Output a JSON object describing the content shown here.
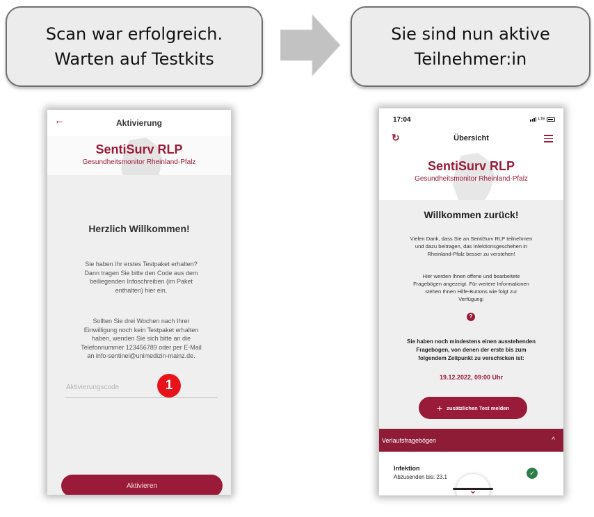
{
  "callouts": {
    "left": "Scan war erfolgreich.\nWarten auf Testkits",
    "right": "Sie sind nun aktive\nTeilnehmer:in"
  },
  "phone_activation": {
    "back_icon": "arrow-left-icon",
    "header_title": "Aktivierung",
    "brand_title": "SentiSurv RLP",
    "brand_subtitle": "Gesundheitsmonitor Rheinland-Pfalz",
    "welcome_title": "Herzlich Willkommen!",
    "paragraph_1": "Sie haben Ihr erstes Testpaket erhalten?\nDann tragen Sie bitte den Code aus dem\nbeiliegenden Infoschreiben (im Paket\nenthalten) hier ein.",
    "paragraph_2": "Sollten Sie drei Wochen nach Ihrer\nEinwilligung noch kein Testpaket erhalten\nhaben, wenden Sie sich bitte an die\nTelefonnummer 123456789 oder per E-Mail\nan info-sentinel@unimedizin-mainz.de.",
    "code_placeholder": "Aktivierungscode",
    "step_badge": "1",
    "activate_button": "Aktivieren",
    "accent_color": "#9a1b39",
    "badge_color": "#e8121a"
  },
  "phone_overview": {
    "status_time": "17:04",
    "status_network": "LTE",
    "refresh_icon": "refresh-icon",
    "header_title": "Übersicht",
    "menu_icon": "hamburger-menu-icon",
    "brand_title": "SentiSurv RLP",
    "brand_subtitle": "Gesundheitsmonitor Rheinland-Pfalz",
    "welcome_title": "Willkommen zurück!",
    "paragraph_1": "Vielen Dank, dass Sie an SentiSurv RLP teilnehmen\nund dazu beitragen, das Infektionsgeschehen in\nRheinland-Pfalz besser zu verstehen!",
    "paragraph_2": "Hier werden Ihnen offene und bearbeitete\nFragebögen angezeigt. Für weitere Informationen\nstehen Ihnen Hilfe-Buttons wie folgt zur\nVerfügung:",
    "help_glyph": "?",
    "pending_text": "Sie haben noch mindestens einen ausstehenden\nFragebogen, von denen der erste bis zum\nfolgendem Zeitpunkt zu verschicken ist:",
    "deadline": "19.12.2022, 09:00 Uhr",
    "add_test_plus": "+",
    "add_test_button": "zusätzlichen Test melden",
    "section_title": "Verlaufsfragebögen",
    "section_chevron": "^",
    "item_title": "Infektion",
    "item_subtitle": "Abzusenden bis: 23.1",
    "item_status_glyph": "✓",
    "scroll_down_glyph": "⌄",
    "accent_color": "#9a1b39",
    "success_color": "#2f7d4a"
  }
}
